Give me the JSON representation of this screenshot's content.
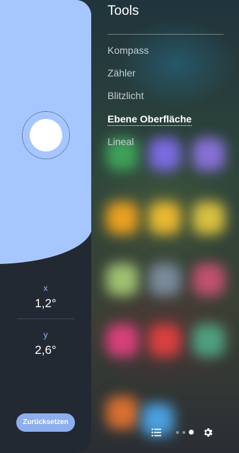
{
  "menu": {
    "title": "Tools",
    "items": [
      {
        "label": "Kompass"
      },
      {
        "label": "Zähler"
      },
      {
        "label": "Blitzlicht"
      },
      {
        "label": "Ebene Oberfläche"
      },
      {
        "label": "Lineal"
      }
    ],
    "active_index": 3
  },
  "level": {
    "x_label": "x",
    "x_value": "1,2°",
    "y_label": "y",
    "y_value": "2,6°",
    "reset_label": "Zurücksetzen"
  },
  "bottom_bar": {
    "icons": [
      "list-icon",
      "page-indicator",
      "gear-icon"
    ],
    "page_count": 3,
    "current_page": 3
  },
  "colors": {
    "level_surface": "#a6c6ff",
    "panel": "#232932",
    "accent": "#8eb4ff",
    "reset_button": "#8eafee"
  }
}
